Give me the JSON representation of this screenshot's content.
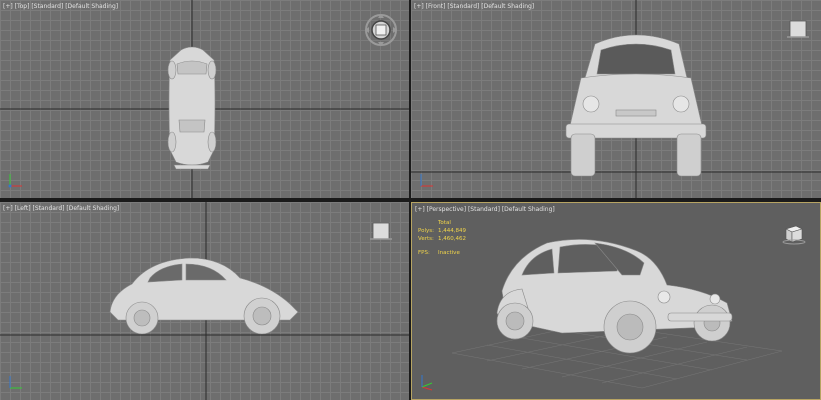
{
  "viewports": {
    "top": {
      "label": "[+] [Top] [Standard] [Default Shading]"
    },
    "front": {
      "label": "[+] [Front] [Standard] [Default Shading]"
    },
    "left": {
      "label": "[+] [Left] [Standard] [Default Shading]"
    },
    "perspective": {
      "label": "[+] [Perspective] [Standard] [Default Shading]",
      "stats": {
        "total_label": "Total",
        "polys_label": "Polys:",
        "polys_value": "1,444,849",
        "verts_label": "Verts:",
        "verts_value": "1,460,462",
        "fps_label": "FPS:",
        "fps_value": "Inactive"
      }
    }
  },
  "colors": {
    "viewport_bg": "#6e6e6e",
    "grid_line": "#7c7c7c",
    "grid_axis": "#2a2a2a",
    "active_border": "#b7a463",
    "stats_text": "#f0d44a",
    "model": "#d9d9d9"
  },
  "icons": [
    "steering-wheel-icon",
    "viewcube-icon",
    "axis-tripod-icon"
  ]
}
